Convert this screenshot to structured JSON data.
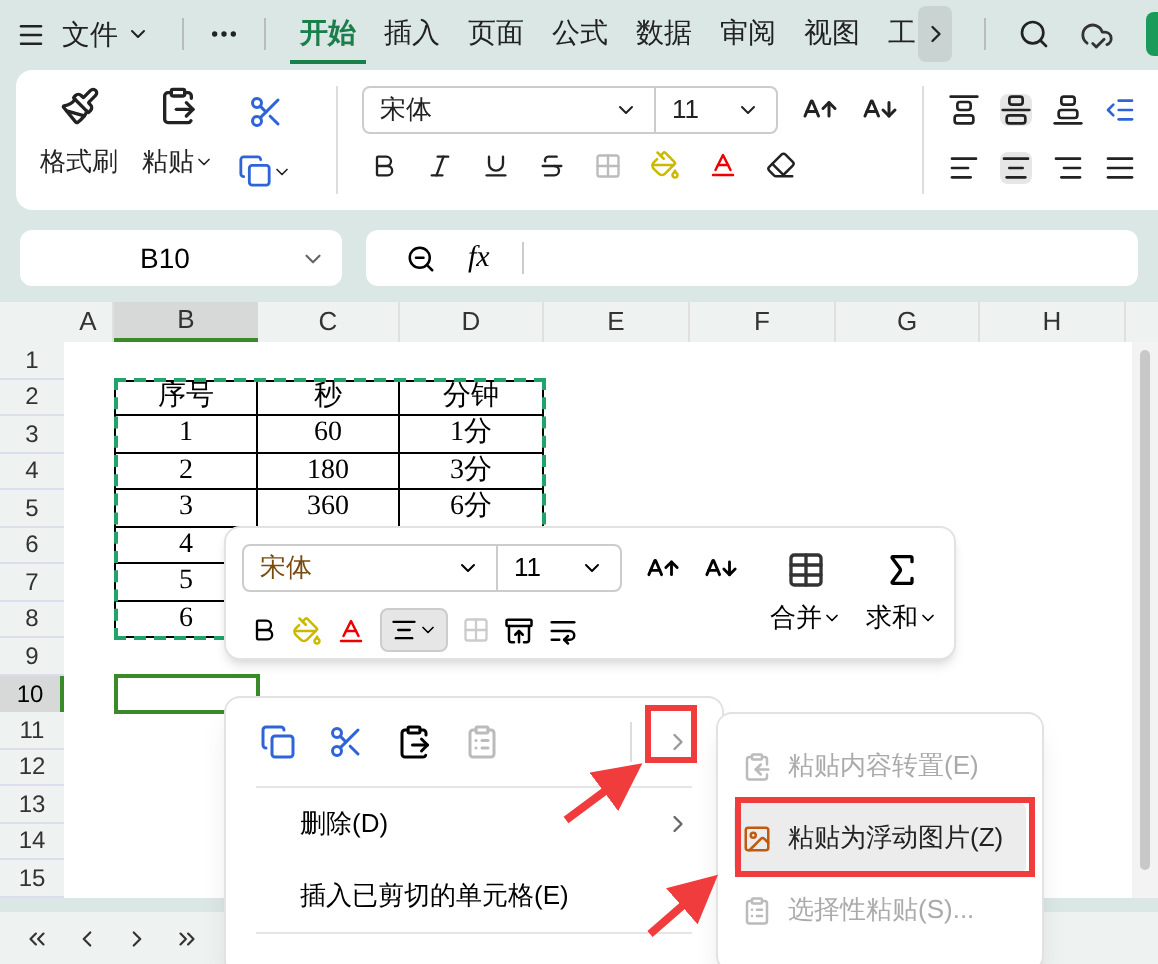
{
  "menu_bar": {
    "file": "文件",
    "tabs": [
      {
        "label": "开始",
        "selected": true
      },
      {
        "label": "插入",
        "selected": false
      },
      {
        "label": "页面",
        "selected": false
      },
      {
        "label": "公式",
        "selected": false
      },
      {
        "label": "数据",
        "selected": false
      },
      {
        "label": "审阅",
        "selected": false
      },
      {
        "label": "视图",
        "selected": false
      },
      {
        "label": "工",
        "selected": false
      }
    ]
  },
  "ribbon": {
    "format_painter": "格式刷",
    "paste": "粘贴",
    "font_name": "宋体",
    "font_size": "11"
  },
  "formula_bar": {
    "name_box": "B10",
    "fx": "fx"
  },
  "columns": [
    {
      "label": "A",
      "selected": false
    },
    {
      "label": "B",
      "selected": true
    },
    {
      "label": "C",
      "selected": false
    },
    {
      "label": "D",
      "selected": false
    },
    {
      "label": "E",
      "selected": false
    },
    {
      "label": "F",
      "selected": false
    },
    {
      "label": "G",
      "selected": false
    },
    {
      "label": "H",
      "selected": false
    }
  ],
  "rows": [
    {
      "label": "1",
      "selected": false
    },
    {
      "label": "2",
      "selected": false
    },
    {
      "label": "3",
      "selected": false
    },
    {
      "label": "4",
      "selected": false
    },
    {
      "label": "5",
      "selected": false
    },
    {
      "label": "6",
      "selected": false
    },
    {
      "label": "7",
      "selected": false
    },
    {
      "label": "8",
      "selected": false
    },
    {
      "label": "9",
      "selected": false
    },
    {
      "label": "10",
      "selected": true
    },
    {
      "label": "11",
      "selected": false
    },
    {
      "label": "12",
      "selected": false
    },
    {
      "label": "13",
      "selected": false
    },
    {
      "label": "14",
      "selected": false
    },
    {
      "label": "15",
      "selected": false
    }
  ],
  "table": {
    "rows": [
      [
        "序号",
        "秒",
        "分钟"
      ],
      [
        "1",
        "60",
        "1分"
      ],
      [
        "2",
        "180",
        "3分"
      ],
      [
        "3",
        "360",
        "6分"
      ],
      [
        "4"
      ],
      [
        "5"
      ],
      [
        "6"
      ]
    ]
  },
  "floating_toolbar": {
    "font_name": "宋体",
    "font_size": "11",
    "align_selected": true,
    "merge": "合并",
    "sum": "求和"
  },
  "context_menu": {
    "items": [
      {
        "label": "删除(D)",
        "submenu": true
      },
      {
        "label": "插入已剪切的单元格(E)",
        "submenu": false
      }
    ]
  },
  "paste_submenu": {
    "items": [
      {
        "label": "粘贴内容转置(E)",
        "disabled": true,
        "selected": false
      },
      {
        "label": "粘贴为浮动图片(Z)",
        "disabled": false,
        "selected": true
      },
      {
        "label": "选择性粘贴(S)...",
        "disabled": true,
        "selected": false
      }
    ]
  }
}
